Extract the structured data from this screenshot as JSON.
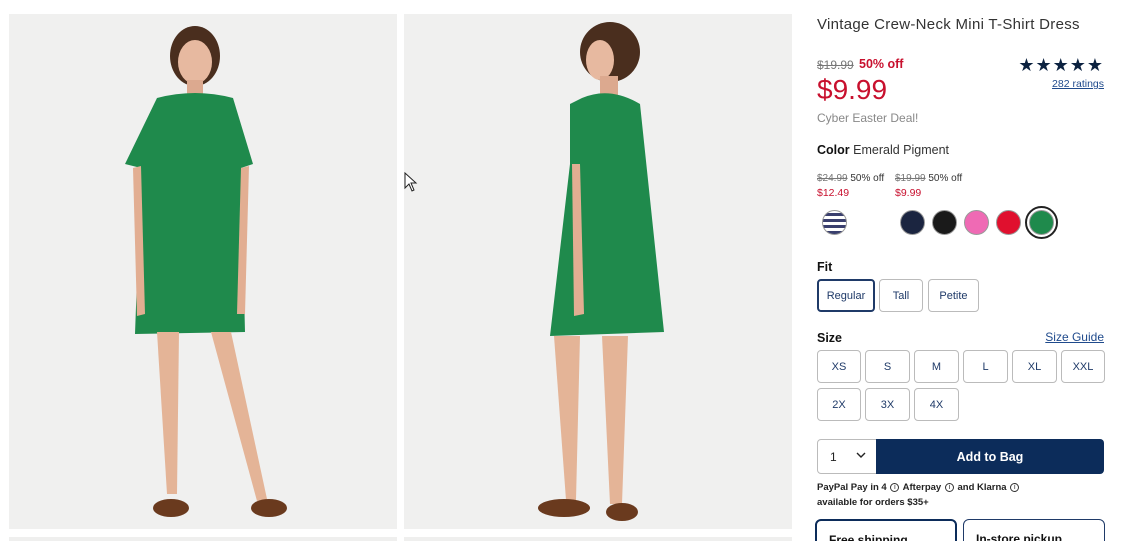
{
  "product": {
    "title": "Vintage Crew-Neck Mini T-Shirt Dress",
    "original_price": "$19.99",
    "discount": "50% off",
    "price": "$9.99",
    "promo": "Cyber Easter Deal!",
    "stars": "★★★★★",
    "rating_value": 4.6,
    "ratings_link": "282 ratings"
  },
  "color": {
    "label": "Color",
    "selected_name": "Emerald Pigment",
    "price_groups": [
      {
        "old": "$24.99",
        "off": "50% off",
        "new": "$12.49"
      },
      {
        "old": "$19.99",
        "off": "50% off",
        "new": "$9.99"
      }
    ],
    "swatches": [
      {
        "name": "navy-stripe",
        "color": "#3a3f6e"
      },
      {
        "name": "white",
        "color": "#ffffff"
      },
      {
        "name": "navy",
        "color": "#1b2540"
      },
      {
        "name": "black",
        "color": "#1a1a1a"
      },
      {
        "name": "pink",
        "color": "#ef6ab4"
      },
      {
        "name": "red",
        "color": "#e0102e"
      },
      {
        "name": "emerald-pigment",
        "color": "#1f8a4c"
      }
    ]
  },
  "fit": {
    "label": "Fit",
    "options": [
      "Regular",
      "Tall",
      "Petite"
    ],
    "selected": "Regular"
  },
  "size": {
    "label": "Size",
    "guide_link": "Size Guide",
    "options": [
      "XS",
      "S",
      "M",
      "L",
      "XL",
      "XXL",
      "2X",
      "3X",
      "4X"
    ]
  },
  "cart": {
    "quantity": "1",
    "add_label": "Add to Bag"
  },
  "payments": {
    "line1_a": "PayPal Pay in 4",
    "line1_b": "Afterpay",
    "line1_c": "and Klarna",
    "line2": "available for orders $35+"
  },
  "fulfillment": {
    "shipping_label": "Free shipping",
    "pickup_label": "In-store pickup"
  },
  "colors": {
    "accent_red": "#c8102e",
    "brand_navy": "#0c2c5a",
    "dress_green": "#1f8a4c"
  }
}
